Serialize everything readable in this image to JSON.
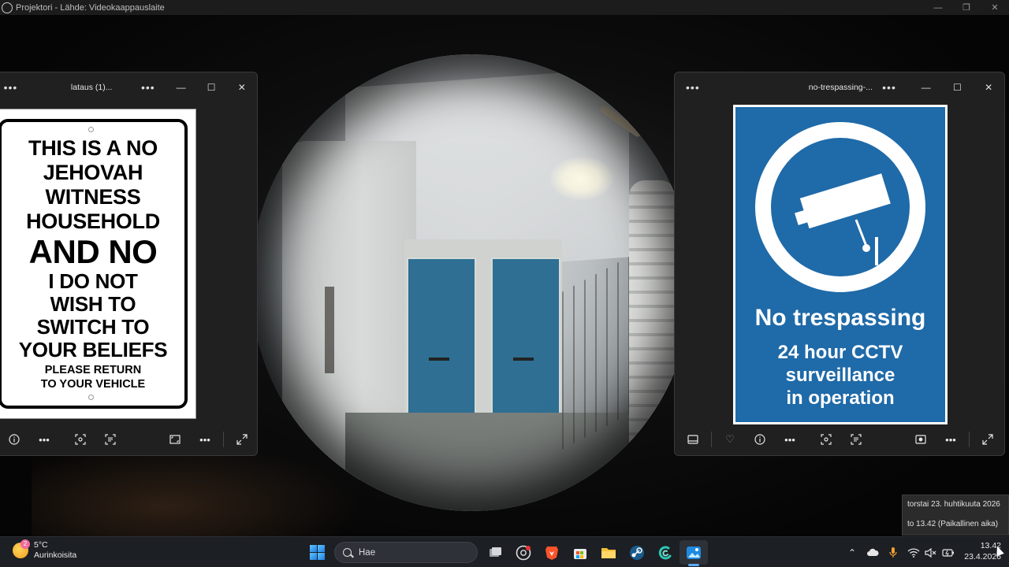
{
  "projector": {
    "title": "Projektori - Lähde: Videokaappauslaite",
    "controls": {
      "minimize": "—",
      "restore": "❐",
      "close": "✕"
    }
  },
  "left_window": {
    "title": "lataus (1)...",
    "menu": "•••",
    "controls": {
      "minimize": "—",
      "maximize": "☐",
      "close": "✕"
    },
    "sign": {
      "line1": "THIS IS A NO",
      "line2": "JEHOVAH",
      "line3": "WITNESS",
      "line4": "HOUSEHOLD",
      "line5": "AND NO",
      "line6": "I DO NOT",
      "line7": "WISH TO",
      "line8": "SWITCH TO",
      "line9": "YOUR BELIEFS",
      "line10": "PLEASE RETURN",
      "line11": "TO YOUR VEHICLE"
    },
    "toolbar": [
      "info-icon",
      "more-icon",
      "scan-icon",
      "text-scan-icon",
      "fit-icon",
      "more-icon",
      "expand-icon"
    ]
  },
  "right_window": {
    "title": "no-trespassing-...",
    "menu": "•••",
    "controls": {
      "minimize": "—",
      "maximize": "☐",
      "close": "✕"
    },
    "sign": {
      "heading": "No trespassing",
      "line1": "24 hour CCTV",
      "line2": "surveillance",
      "line3": "in operation",
      "bg_color": "#1f6aa8"
    },
    "toolbar": [
      "filmstrip-icon",
      "heart-icon",
      "info-icon",
      "more-icon",
      "scan-icon",
      "text-scan-icon",
      "capture-icon",
      "more-icon",
      "expand-icon"
    ]
  },
  "clock_tooltip": {
    "date_long": "torstai 23. huhtikuuta 2026",
    "time_long": "to 13.42 (Paikallinen aika)"
  },
  "taskbar": {
    "weather": {
      "temp": "5°C",
      "condition": "Aurinkoisita",
      "badge": "2"
    },
    "search_placeholder": "Hae",
    "apps": [
      "windows-start-icon",
      "task-view-icon",
      "chrome-icon",
      "brave-icon",
      "store-icon",
      "file-explorer-icon",
      "steam-icon",
      "copilot-icon",
      "photos-icon"
    ],
    "time": "13.42",
    "date": "23.4.2026"
  }
}
